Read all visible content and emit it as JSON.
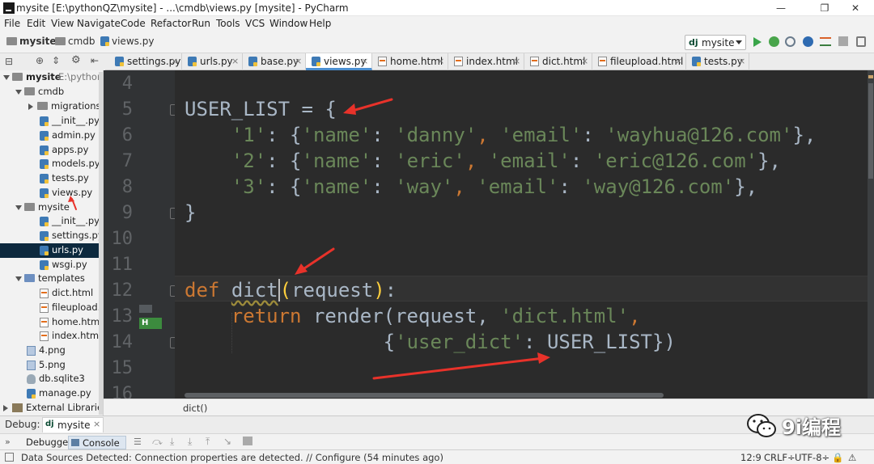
{
  "window": {
    "title": "mysite [E:\\pythonQZ\\mysite] - ...\\cmdb\\views.py [mysite] - PyCharm",
    "controls": [
      "—",
      "❐",
      "✕"
    ]
  },
  "menu": [
    "File",
    "Edit",
    "View",
    "Navigate",
    "Code",
    "Refactor",
    "Run",
    "Tools",
    "VCS",
    "Window",
    "Help"
  ],
  "nav": {
    "breadcrumbs": [
      "mysite",
      "cmdb",
      "views.py"
    ],
    "run_config": "mysite",
    "run_config_icon": "dj"
  },
  "tabs": [
    {
      "label": "settings.py",
      "icon": "python-file-icon"
    },
    {
      "label": "urls.py",
      "icon": "python-file-icon"
    },
    {
      "label": "base.py",
      "icon": "python-file-icon"
    },
    {
      "label": "views.py",
      "icon": "python-file-icon",
      "active": true
    },
    {
      "label": "home.html",
      "icon": "html-file-icon"
    },
    {
      "label": "index.html",
      "icon": "html-file-icon"
    },
    {
      "label": "dict.html",
      "icon": "html-file-icon"
    },
    {
      "label": "fileupload.html",
      "icon": "html-file-icon"
    },
    {
      "label": "tests.py",
      "icon": "python-file-icon"
    }
  ],
  "project": {
    "root": "mysite",
    "root_path": "E:\\pythonQ",
    "items": [
      {
        "label": "cmdb",
        "type": "folder"
      },
      {
        "label": "migrations",
        "type": "folder"
      },
      {
        "label": "__init__.py",
        "type": "py"
      },
      {
        "label": "admin.py",
        "type": "py"
      },
      {
        "label": "apps.py",
        "type": "py"
      },
      {
        "label": "models.py",
        "type": "py"
      },
      {
        "label": "tests.py",
        "type": "py"
      },
      {
        "label": "views.py",
        "type": "py"
      },
      {
        "label": "mysite",
        "type": "folder"
      },
      {
        "label": "__init__.py",
        "type": "py"
      },
      {
        "label": "settings.py",
        "type": "py"
      },
      {
        "label": "urls.py",
        "type": "py",
        "selected": true
      },
      {
        "label": "wsgi.py",
        "type": "py"
      },
      {
        "label": "templates",
        "type": "folder"
      },
      {
        "label": "dict.html",
        "type": "html"
      },
      {
        "label": "fileupload.htm",
        "type": "html"
      },
      {
        "label": "home.html",
        "type": "html"
      },
      {
        "label": "index.html",
        "type": "html"
      },
      {
        "label": "4.png",
        "type": "img"
      },
      {
        "label": "5.png",
        "type": "img"
      },
      {
        "label": "db.sqlite3",
        "type": "db"
      },
      {
        "label": "manage.py",
        "type": "py"
      },
      {
        "label": "External Libraries",
        "type": "lib"
      }
    ]
  },
  "editor": {
    "line_numbers": [
      "4",
      "5",
      "6",
      "7",
      "8",
      "9",
      "10",
      "11",
      "12",
      "13",
      "14",
      "15",
      "16"
    ],
    "code": {
      "l5": [
        "USER_LIST",
        " = {"
      ],
      "l6": [
        "'1'",
        ": {",
        "'name'",
        ": ",
        "'danny'",
        ", ",
        "'email'",
        ": ",
        "'wayhua@126.com'",
        "},"
      ],
      "l7": [
        "'2'",
        ": {",
        "'name'",
        ": ",
        "'eric'",
        ", ",
        "'email'",
        ": ",
        "'eric@126.com'",
        "},"
      ],
      "l8": [
        "'3'",
        ": {",
        "'name'",
        ": ",
        "'way'",
        ", ",
        "'email'",
        ": ",
        "'way@126.com'",
        "},"
      ],
      "l9": [
        "}"
      ],
      "l12": [
        "def",
        " ",
        "dict",
        "(",
        "request",
        ")",
        ":"
      ],
      "l13": [
        "return",
        " render(request, ",
        "'dict.html'",
        ","
      ],
      "l14": [
        "{",
        "'user_dict'",
        ": USER_LIST})"
      ]
    },
    "gutter_badge": "H",
    "breadcrumb": "dict()"
  },
  "debug": {
    "label": "Debug:",
    "config": "mysite",
    "tabs": [
      "Debugger",
      "Console"
    ]
  },
  "status": {
    "message": "Data Sources Detected: Connection properties are detected. // Configure (54 minutes ago)",
    "position": "12:9",
    "line_sep": "CRLF÷",
    "encoding": "UTF-8÷"
  },
  "watermark": "9i编程",
  "colors": {
    "keyword": "#cc7832",
    "string": "#6a8759",
    "text": "#a9b7c6",
    "paren_match": "#fecf3d",
    "editor_bg": "#2b2b2b",
    "annotation_arrow": "#e8322a"
  }
}
